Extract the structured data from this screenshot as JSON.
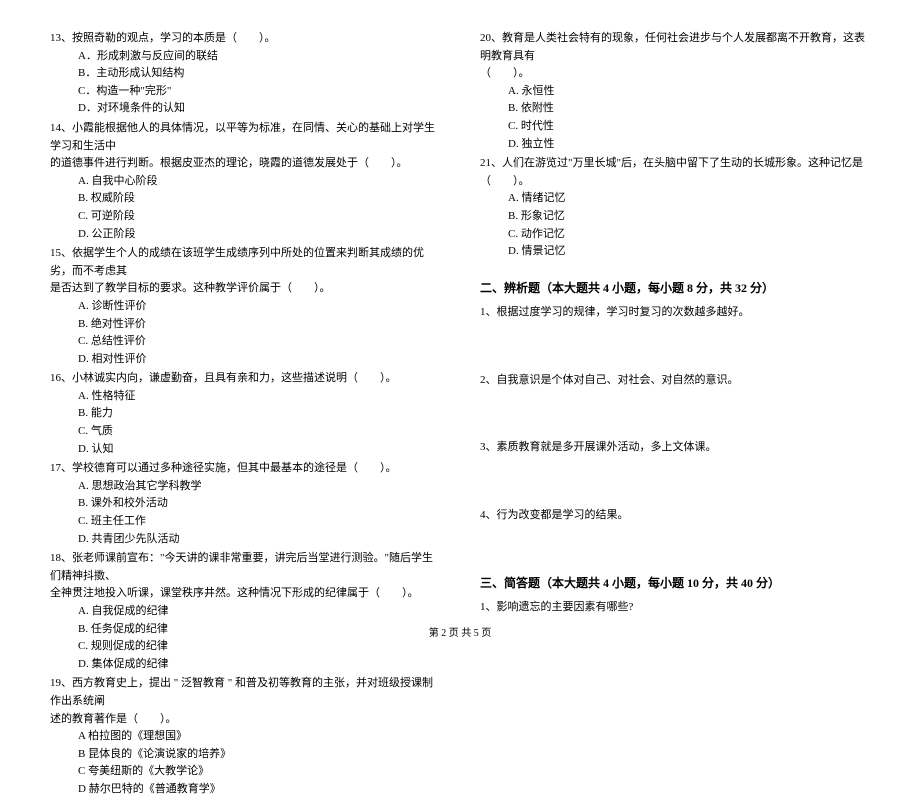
{
  "left": {
    "q13": {
      "stem": "13、按照奇勒的观点，学习的本质是（　　）。",
      "opts": [
        "A．形成刺激与反应间的联结",
        "B．主动形成认知结构",
        "C．构造一种\"完形\"",
        "D．对环境条件的认知"
      ]
    },
    "q14": {
      "stem1": "14、小霞能根据他人的具体情况，以平等为标准，在同情、关心的基础上对学生学习和生活中",
      "stem2": "的道德事件进行判断。根据皮亚杰的理论，晓霞的道德发展处于（　　）。",
      "opts": [
        "A. 自我中心阶段",
        "B. 权威阶段",
        "C. 可逆阶段",
        "D. 公正阶段"
      ]
    },
    "q15": {
      "stem1": "15、依据学生个人的成绩在该班学生成绩序列中所处的位置来判断其成绩的优劣，而不考虑其",
      "stem2": "是否达到了教学目标的要求。这种教学评价属于（　　）。",
      "opts": [
        "A. 诊断性评价",
        "B. 绝对性评价",
        "C. 总结性评价",
        "D. 相对性评价"
      ]
    },
    "q16": {
      "stem": "16、小林诚实内向，谦虚勤奋，且具有亲和力，这些描述说明（　　）。",
      "opts": [
        "A. 性格特征",
        "B. 能力",
        "C. 气质",
        "D. 认知"
      ]
    },
    "q17": {
      "stem": "17、学校德育可以通过多种途径实施，但其中最基本的途径是（　　）。",
      "opts": [
        "A. 思想政治其它学科教学",
        "B. 课外和校外活动",
        "C. 班主任工作",
        "D. 共青团少先队活动"
      ]
    },
    "q18": {
      "stem1": "18、张老师课前宣布：\"今天讲的课非常重要，讲完后当堂进行测验。\"随后学生们精神抖擞、",
      "stem2": "全神贯注地投入听课，课堂秩序井然。这种情况下形成的纪律属于（　　）。",
      "opts": [
        "A. 自我促成的纪律",
        "B. 任务促成的纪律",
        "C. 规则促成的纪律",
        "D. 集体促成的纪律"
      ]
    },
    "q19": {
      "stem1": "19、西方教育史上，提出 \" 泛智教育 \" 和普及初等教育的主张，并对班级授课制作出系统阐",
      "stem2": "述的教育著作是（　　）。",
      "opts": [
        "A 柏拉图的《理想国》",
        "B 昆体良的《论演说家的培养》",
        "C 夸美纽斯的《大教学论》",
        "D 赫尔巴特的《普通教育学》"
      ]
    }
  },
  "right": {
    "q20": {
      "stem1": "20、教育是人类社会特有的现象，任何社会进步与个人发展都离不开教育，这表明教育具有",
      "stem2": "（　　）。",
      "opts": [
        "A. 永恒性",
        "B. 依附性",
        "C. 时代性",
        "D. 独立性"
      ]
    },
    "q21": {
      "stem": "21、人们在游览过\"万里长城\"后，在头脑中留下了生动的长城形象。这种记忆是（　　）。",
      "opts": [
        "A. 情绪记忆",
        "B. 形象记忆",
        "C. 动作记忆",
        "D. 情景记忆"
      ]
    },
    "section2": {
      "title": "二、辨析题（本大题共 4 小题，每小题 8 分，共 32 分）",
      "q1": "1、根据过度学习的规律，学习时复习的次数越多越好。",
      "q2": "2、自我意识是个体对自己、对社会、对自然的意识。",
      "q3": "3、素质教育就是多开展课外活动，多上文体课。",
      "q4": "4、行为改变都是学习的结果。"
    },
    "section3": {
      "title": "三、简答题（本大题共 4 小题，每小题 10 分，共 40 分）",
      "q1": "1、影响遗忘的主要因素有哪些?"
    }
  },
  "footer": "第 2 页 共 5 页"
}
